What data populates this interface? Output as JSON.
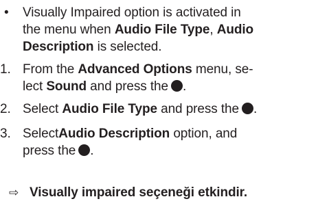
{
  "bullet": {
    "marker": "•",
    "line1": "Visually Impaired option is activated in",
    "line2_pre": "the menu when ",
    "line2_b1": "Audio File Type",
    "line2_sep": ", ",
    "line2_b2": "Audio",
    "line3_b": "Description",
    "line3_post": " is selected."
  },
  "steps": [
    {
      "num": "1.",
      "line1_pre": "From the ",
      "line1_b": "Advanced Options",
      "line1_post": " menu, se-",
      "line2_pre": "lect ",
      "line2_b": "Sound",
      "line2_post": " and press the",
      "end": "."
    },
    {
      "num": "2.",
      "line1_pre": "Select ",
      "line1_b": "Audio File Type",
      "line1_post": " and press the",
      "end": "."
    },
    {
      "num": "3.",
      "line1_pre": "Select",
      "line1_b": "Audio Description",
      "line1_post": " option, and",
      "line2_pre": "press the",
      "end": "."
    }
  ],
  "result": {
    "marker": "⇨",
    "text": "Visually impaired seçeneği etkindir."
  },
  "icons": {
    "ok_button": "filled-circle-icon"
  },
  "colors": {
    "text": "#231f20"
  }
}
